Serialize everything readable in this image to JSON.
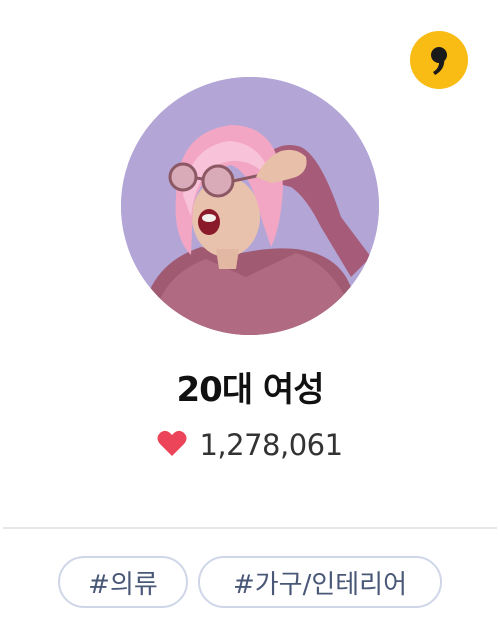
{
  "badge": {
    "icon": "comma-quote-icon",
    "color": "#f9bc15"
  },
  "profile": {
    "title": "20대 여성",
    "likes_icon": "heart-icon",
    "likes_count": "1,278,061"
  },
  "tags": [
    {
      "label": "#의류"
    },
    {
      "label": "#가구/인테리어"
    }
  ],
  "colors": {
    "heart": "#ec4459",
    "tag_border": "#cfd6e8",
    "tag_text": "#4a5878",
    "avatar_bg": "#b3a6d6"
  }
}
